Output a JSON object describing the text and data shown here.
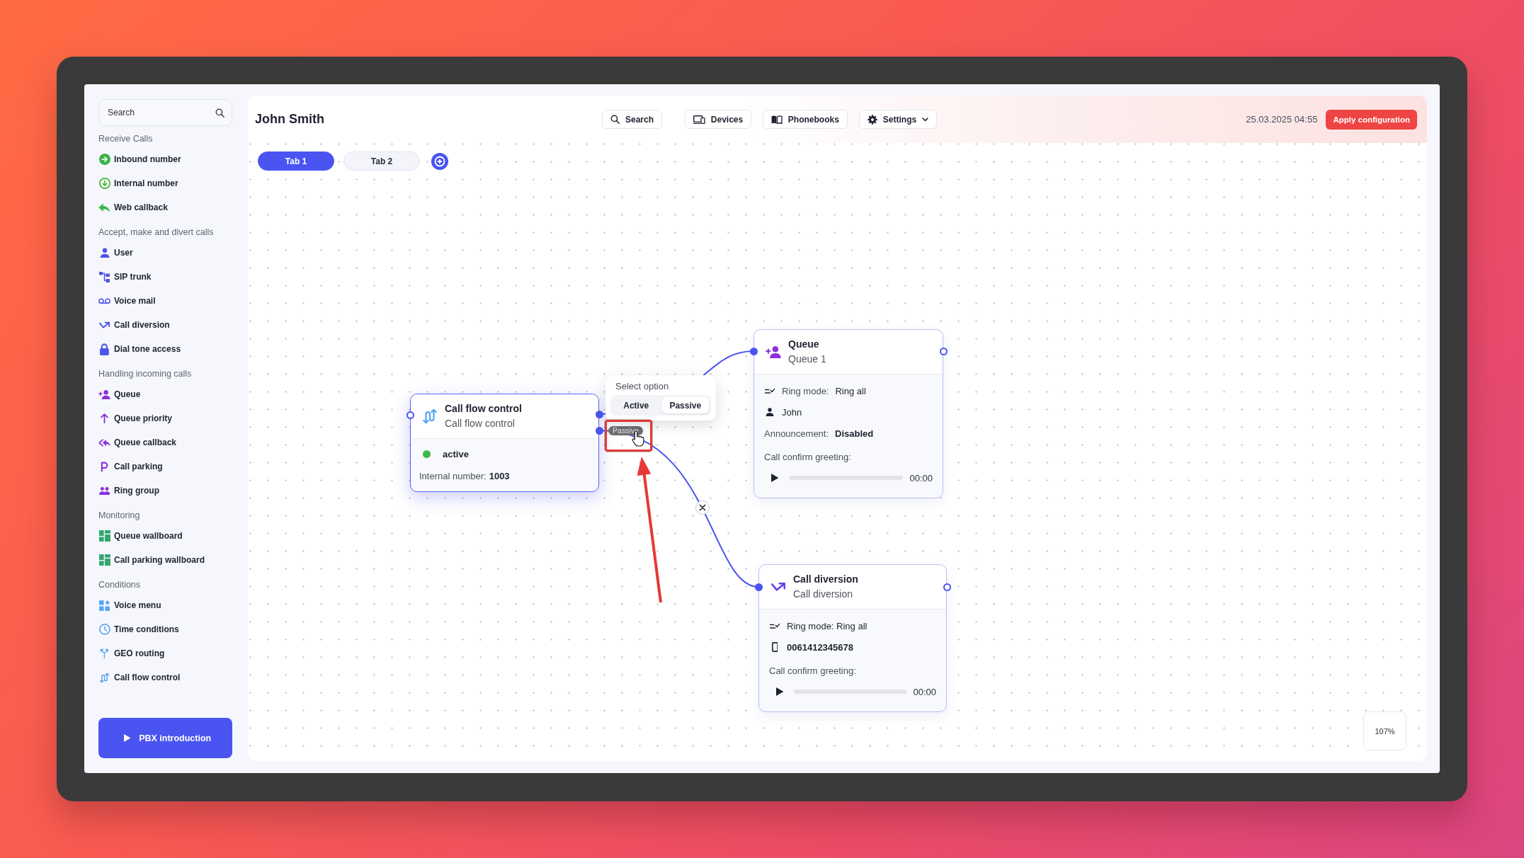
{
  "sidebar": {
    "search": {
      "placeholder": "Search"
    },
    "sections": [
      {
        "title": "Receive Calls",
        "items": [
          {
            "label": "Inbound number",
            "kind": "inbound"
          },
          {
            "label": "Internal number",
            "kind": "internal"
          },
          {
            "label": "Web callback",
            "kind": "webcallback"
          }
        ]
      },
      {
        "title": "Accept, make and divert calls",
        "items": [
          {
            "label": "User",
            "kind": "user"
          },
          {
            "label": "SIP trunk",
            "kind": "trunk"
          },
          {
            "label": "Voice mail",
            "kind": "voicemail"
          },
          {
            "label": "Call diversion",
            "kind": "diversion"
          },
          {
            "label": "Dial tone access",
            "kind": "lock"
          }
        ]
      },
      {
        "title": "Handling incoming calls",
        "items": [
          {
            "label": "Queue",
            "kind": "queue"
          },
          {
            "label": "Queue priority",
            "kind": "priority"
          },
          {
            "label": "Queue callback",
            "kind": "callback"
          },
          {
            "label": "Call parking",
            "kind": "parking"
          },
          {
            "label": "Ring group",
            "kind": "group"
          }
        ]
      },
      {
        "title": "Monitoring",
        "items": [
          {
            "label": "Queue wallboard",
            "kind": "wallboard"
          },
          {
            "label": "Call parking wallboard",
            "kind": "wallboard"
          }
        ]
      },
      {
        "title": "Conditions",
        "items": [
          {
            "label": "Voice menu",
            "kind": "menu"
          },
          {
            "label": "Time conditions",
            "kind": "time"
          },
          {
            "label": "GEO routing",
            "kind": "geo"
          },
          {
            "label": "Call flow control",
            "kind": "flow"
          }
        ]
      }
    ],
    "intro_button": {
      "label": "PBX introduction"
    }
  },
  "header": {
    "title": "John Smith",
    "buttons": [
      {
        "label": "Search",
        "kind": "search"
      },
      {
        "label": "Devices",
        "kind": "devices"
      },
      {
        "label": "Phonebooks",
        "kind": "phonebooks"
      },
      {
        "label": "Settings",
        "kind": "settings"
      }
    ],
    "datetime": "25.03.2025 04:55",
    "apply_button": "Apply configuration"
  },
  "tabs": [
    {
      "label": "Tab 1",
      "selected": true
    },
    {
      "label": "Tab 2",
      "selected": false
    }
  ],
  "canvas": {
    "nodes": [
      {
        "kind": "flow",
        "title": "Call flow control",
        "subtitle": "Call flow control",
        "selected": true,
        "status": {
          "label": "active",
          "on": true
        },
        "fields": [
          {
            "label": "Internal number:",
            "value": "1003"
          }
        ]
      },
      {
        "kind": "queue",
        "title": "Queue",
        "subtitle": "Queue 1",
        "selected": false,
        "rows": [
          {
            "kind": "ringmode",
            "label": "Ring mode:",
            "value": "Ring all"
          },
          {
            "kind": "user",
            "value": "John"
          },
          {
            "kind": "plain",
            "label": "Announcement:",
            "value": "Disabled"
          }
        ],
        "greeting": {
          "label": "Call confirm greeting:",
          "time": "00:00"
        }
      },
      {
        "kind": "diversion",
        "title": "Call diversion",
        "subtitle": "Call diversion",
        "selected": false,
        "rows": [
          {
            "kind": "ringmode",
            "value": "Ring mode: Ring all"
          },
          {
            "kind": "phone",
            "value": "0061412345678"
          }
        ],
        "greeting": {
          "label": "Call confirm greeting:",
          "time": "00:00"
        }
      }
    ],
    "option_picker": {
      "placeholder": "Select option",
      "options": [
        {
          "label": "Active",
          "selected": false
        },
        {
          "label": "Passive",
          "selected": true
        }
      ]
    },
    "edge_label": "Passive",
    "zoom": "107%"
  }
}
